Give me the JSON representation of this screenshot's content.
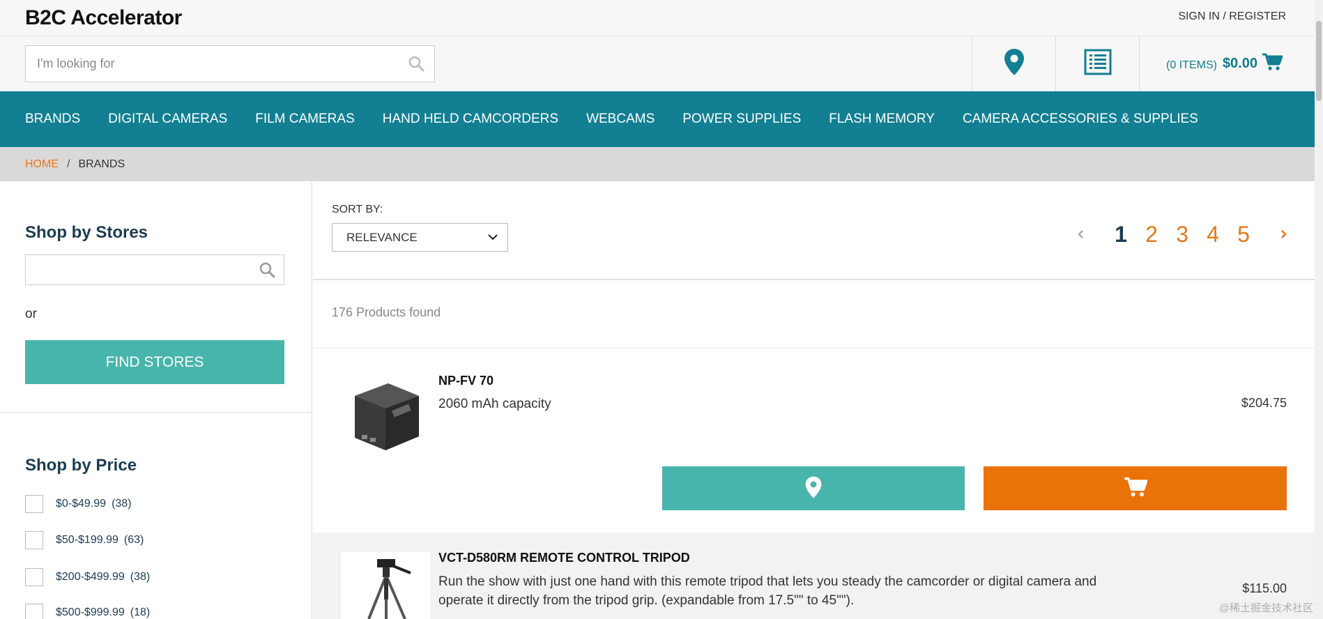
{
  "app": {
    "logo": "B2C Accelerator",
    "signin": "SIGN IN / REGISTER"
  },
  "search": {
    "placeholder": "I'm looking for",
    "value": ""
  },
  "header_icons": [
    "map-pin-icon",
    "list-icon"
  ],
  "cart": {
    "items_label": "(0 ITEMS)",
    "total": "$0.00"
  },
  "nav": {
    "items": [
      "BRANDS",
      "DIGITAL CAMERAS",
      "FILM CAMERAS",
      "HAND HELD CAMCORDERS",
      "WEBCAMS",
      "POWER SUPPLIES",
      "FLASH MEMORY",
      "CAMERA ACCESSORIES & SUPPLIES"
    ]
  },
  "breadcrumb": {
    "home": "HOME",
    "separator": "/",
    "current": "BRANDS"
  },
  "sidebar": {
    "stores_heading": "Shop by Stores",
    "or_label": "or",
    "find_stores_label": "FIND STORES",
    "price_heading": "Shop by Price",
    "price_filters": [
      {
        "label": "$0-$49.99",
        "count": "(38)"
      },
      {
        "label": "$50-$199.99",
        "count": "(63)"
      },
      {
        "label": "$200-$499.99",
        "count": "(38)"
      },
      {
        "label": "$500-$999.99",
        "count": "(18)"
      }
    ]
  },
  "sort": {
    "label": "SORT BY:",
    "selected": "RELEVANCE"
  },
  "pagination": {
    "pages": [
      "1",
      "2",
      "3",
      "4",
      "5"
    ],
    "current": "1"
  },
  "results": {
    "found_text": "176 Products found"
  },
  "products": [
    {
      "name": "NP-FV 70",
      "description": "2060 mAh capacity",
      "price": "$204.75"
    },
    {
      "name": "VCT-D580RM REMOTE CONTROL TRIPOD",
      "description": "Run the show with just one hand with this remote tripod that lets you steady the camcorder or digital camera and operate it directly from the tripod grip. (expandable from 17.5\"\" to 45\"\").",
      "price": "$115.00"
    }
  ],
  "watermark": "@稀土掘金技术社区",
  "colors": {
    "teal": "#127f92",
    "button_teal": "#48b5ad",
    "orange": "#e87718",
    "navy": "#1b3b52"
  }
}
